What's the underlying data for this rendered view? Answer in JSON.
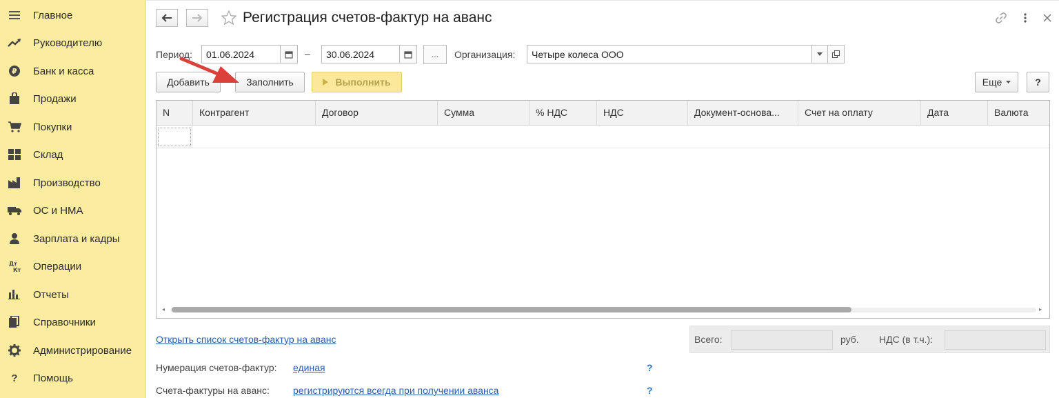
{
  "sidebar": {
    "items": [
      {
        "label": "Главное",
        "icon": "menu-icon"
      },
      {
        "label": "Руководителю",
        "icon": "trend-icon"
      },
      {
        "label": "Банк и касса",
        "icon": "ruble-coin-icon"
      },
      {
        "label": "Продажи",
        "icon": "shopping-bag-icon"
      },
      {
        "label": "Покупки",
        "icon": "cart-icon"
      },
      {
        "label": "Склад",
        "icon": "warehouse-grid-icon"
      },
      {
        "label": "Производство",
        "icon": "factory-icon"
      },
      {
        "label": "ОС и НМА",
        "icon": "truck-icon"
      },
      {
        "label": "Зарплата и кадры",
        "icon": "person-icon"
      },
      {
        "label": "Операции",
        "icon": "dt-kt-icon"
      },
      {
        "label": "Отчеты",
        "icon": "bar-chart-icon"
      },
      {
        "label": "Справочники",
        "icon": "books-icon"
      },
      {
        "label": "Администрирование",
        "icon": "gear-icon"
      },
      {
        "label": "Помощь",
        "icon": "question-icon"
      }
    ]
  },
  "header": {
    "title": "Регистрация счетов-фактур на аванс"
  },
  "filters": {
    "period_label": "Период:",
    "date_from": "01.06.2024",
    "dash": "–",
    "date_to": "30.06.2024",
    "dots": "...",
    "org_label": "Организация:",
    "org_value": "Четыре колеса ООО"
  },
  "toolbar": {
    "add": "Добавить",
    "fill": "Заполнить",
    "run": "Выполнить",
    "more": "Еще",
    "help": "?"
  },
  "table": {
    "columns": [
      "N",
      "Контрагент",
      "Договор",
      "Сумма",
      "% НДС",
      "НДС",
      "Документ-основа...",
      "Счет на оплату",
      "Дата",
      "Валюта"
    ]
  },
  "footer": {
    "open_list_link": "Открыть список счетов-фактур на аванс",
    "total_label": "Всего:",
    "currency": "руб.",
    "vat_label": "НДС (в т.ч.):",
    "numbering_label": "Нумерация счетов-фактур:",
    "numbering_value": "единая",
    "invoices_label": "Счета-фактуры на аванс:",
    "invoices_value": "регистрируются всегда при получении аванса",
    "hint": "?"
  },
  "colors": {
    "sidebar_bg": "#fbeca0",
    "run_button_bg": "#fbe89b",
    "link": "#2a5db0",
    "arrow": "#d9413a"
  }
}
